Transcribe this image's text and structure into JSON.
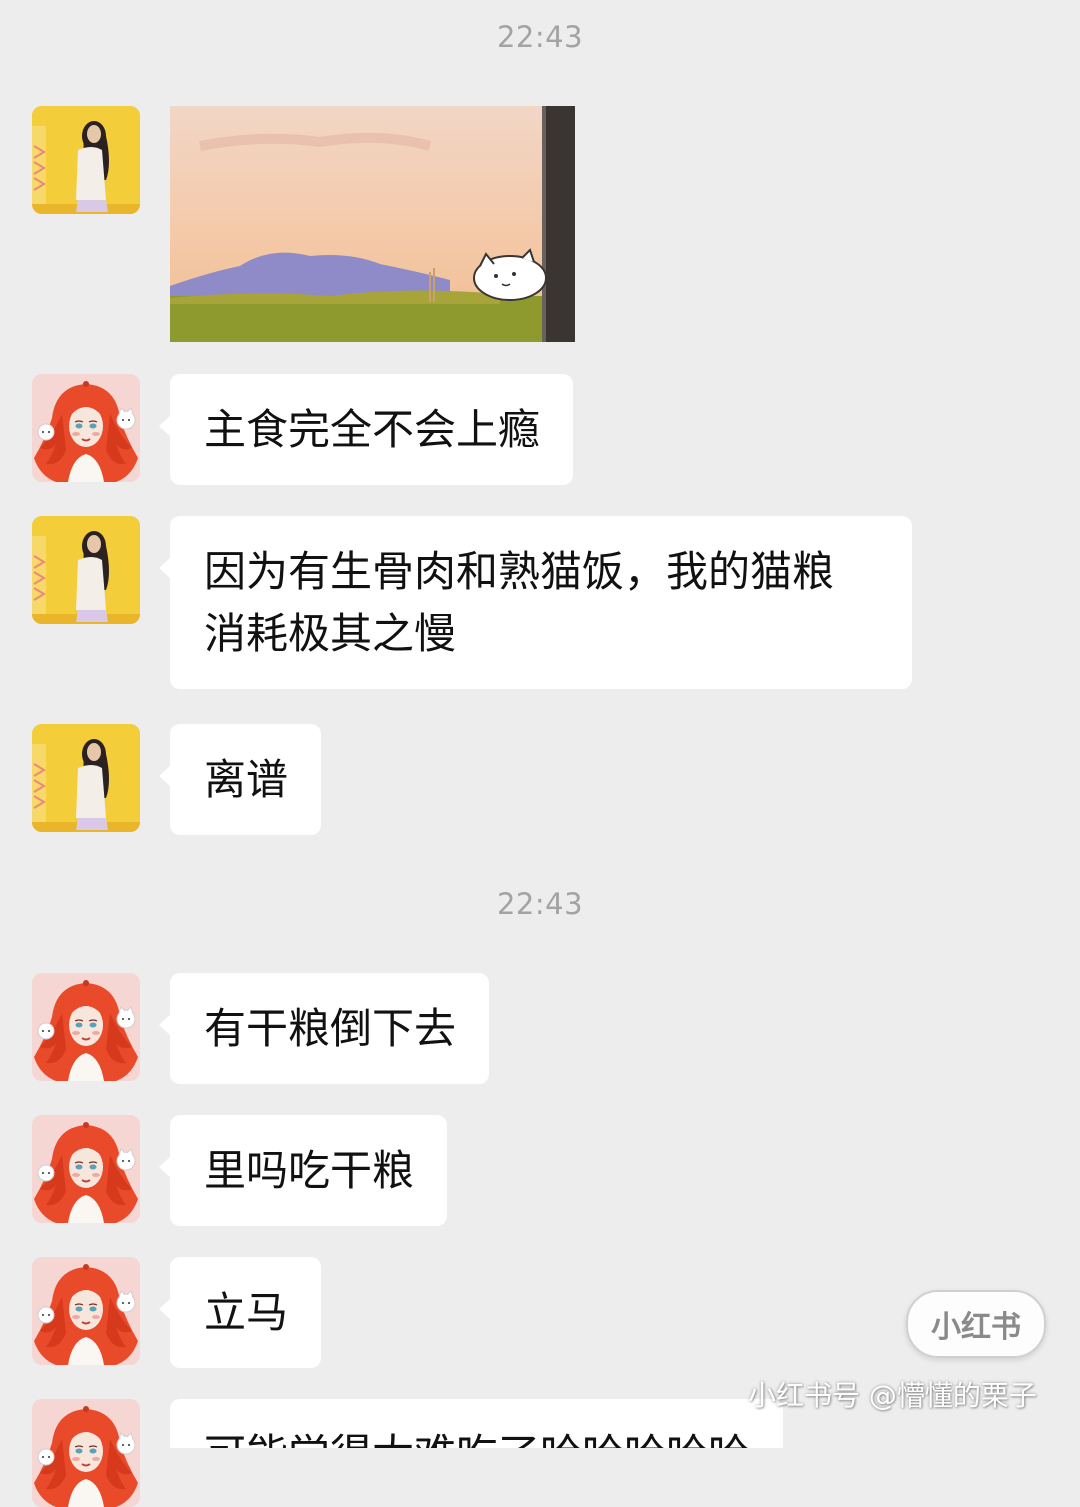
{
  "chat": {
    "timestamps": [
      "22:43",
      "22:43"
    ],
    "messages": [
      {
        "sender": "contact-a",
        "kind": "image",
        "image_desc": "cat-sticker"
      },
      {
        "sender": "contact-b",
        "kind": "text",
        "text": "主食完全不会上瘾"
      },
      {
        "sender": "contact-a",
        "kind": "text",
        "lines": [
          "因为有生骨肉和熟猫饭，我的猫粮",
          "消耗极其之慢"
        ]
      },
      {
        "sender": "contact-a",
        "kind": "text",
        "text": "离谱"
      },
      {
        "sender": "contact-b",
        "kind": "text",
        "text": "有干粮倒下去"
      },
      {
        "sender": "contact-b",
        "kind": "text",
        "text": "里吗吃干粮"
      },
      {
        "sender": "contact-b",
        "kind": "text",
        "text": "立马"
      },
      {
        "sender": "contact-b",
        "kind": "text",
        "text": "可能觉得太难吃了哈哈哈哈哈"
      }
    ]
  },
  "watermark": {
    "badge": "小红书",
    "text": "小红书号 @懵懂的栗子"
  },
  "colors": {
    "background": "#ededed",
    "bubble": "#ffffff",
    "timestamp": "#a3a3a3",
    "text": "#111111"
  }
}
